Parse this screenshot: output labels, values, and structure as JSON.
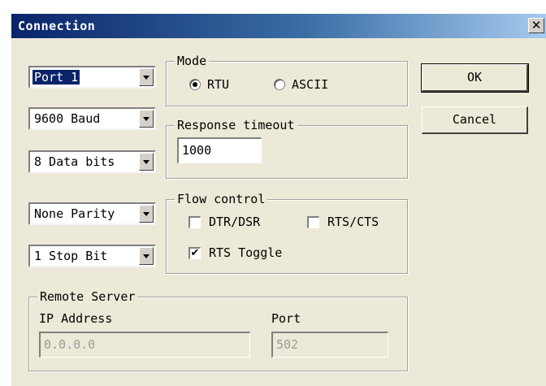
{
  "window": {
    "title": "Connection",
    "close_glyph": "✕"
  },
  "port": "Port 1",
  "baud": "9600 Baud",
  "data_bits": "8 Data bits",
  "parity": "None Parity",
  "stop_bits": "1 Stop Bit",
  "mode": {
    "label": "Mode",
    "rtu": "RTU",
    "ascii": "ASCII",
    "selected": "RTU"
  },
  "response_timeout": {
    "label": "Response timeout",
    "value": "1000"
  },
  "flow_control": {
    "label": "Flow control",
    "dtr_dsr": {
      "label": "DTR/DSR",
      "checked": false
    },
    "rts_cts": {
      "label": "RTS/CTS",
      "checked": false
    },
    "rts_toggle": {
      "label": "RTS Toggle",
      "checked": true
    }
  },
  "remote_server": {
    "label": "Remote Server",
    "ip_label": "IP Address",
    "ip_value": "0.0.0.0",
    "port_label": "Port",
    "port_value": "502"
  },
  "buttons": {
    "ok": "OK",
    "cancel": "Cancel"
  }
}
